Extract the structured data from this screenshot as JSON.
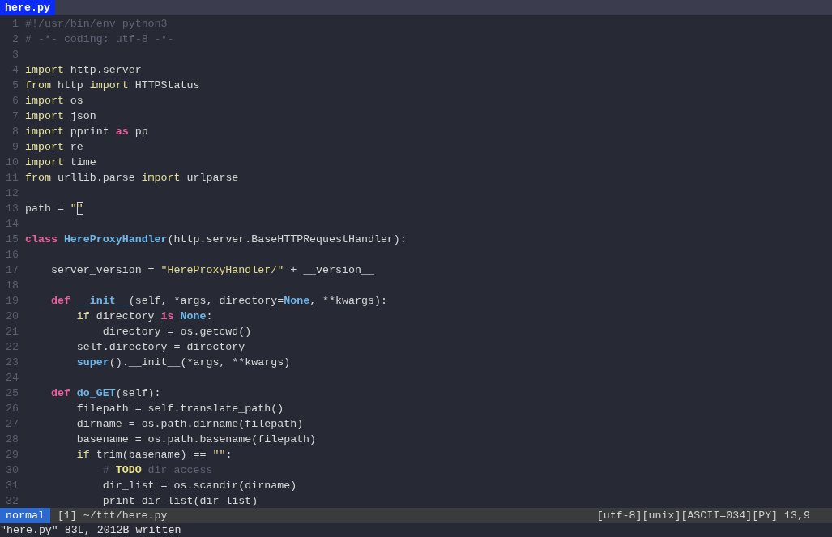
{
  "tabs": [
    {
      "label": "here.py",
      "selected": true
    }
  ],
  "lines": [
    {
      "number": "1",
      "tokens": [
        {
          "kind": "comment",
          "text": "#!/usr/bin/env python3"
        }
      ]
    },
    {
      "number": "2",
      "tokens": [
        {
          "kind": "comment",
          "text": "# -*- coding: utf-8 -*-"
        }
      ]
    },
    {
      "number": "3"
    },
    {
      "number": "4",
      "tokens": [
        {
          "kind": "keyword",
          "text": "import"
        },
        {
          "kind": "plain",
          "text": " http.server"
        }
      ]
    },
    {
      "number": "5",
      "tokens": [
        {
          "kind": "keyword",
          "text": "from"
        },
        {
          "kind": "plain",
          "text": " http "
        },
        {
          "kind": "keyword",
          "text": "import"
        },
        {
          "kind": "plain",
          "text": " HTTPStatus"
        }
      ]
    },
    {
      "number": "6",
      "tokens": [
        {
          "kind": "keyword",
          "text": "import"
        },
        {
          "kind": "plain",
          "text": " os"
        }
      ]
    },
    {
      "number": "7",
      "tokens": [
        {
          "kind": "keyword",
          "text": "import"
        },
        {
          "kind": "plain",
          "text": " json"
        }
      ]
    },
    {
      "number": "8",
      "tokens": [
        {
          "kind": "keyword",
          "text": "import"
        },
        {
          "kind": "plain",
          "text": " pprint "
        },
        {
          "kind": "statement",
          "text": "as"
        },
        {
          "kind": "plain",
          "text": " pp"
        }
      ]
    },
    {
      "number": "9",
      "tokens": [
        {
          "kind": "keyword",
          "text": "import"
        },
        {
          "kind": "plain",
          "text": " re"
        }
      ]
    },
    {
      "number": "10",
      "tokens": [
        {
          "kind": "keyword",
          "text": "import"
        },
        {
          "kind": "plain",
          "text": " time"
        }
      ]
    },
    {
      "number": "11",
      "tokens": [
        {
          "kind": "keyword",
          "text": "from"
        },
        {
          "kind": "plain",
          "text": " urllib.parse "
        },
        {
          "kind": "keyword",
          "text": "import"
        },
        {
          "kind": "plain",
          "text": " urlparse"
        }
      ]
    },
    {
      "number": "12"
    },
    {
      "number": "13",
      "tokens": [
        {
          "kind": "plain",
          "text": "path = "
        },
        {
          "kind": "string",
          "text": "\""
        },
        {
          "kind": "cursor",
          "text": "\""
        }
      ]
    },
    {
      "number": "14"
    },
    {
      "number": "15",
      "tokens": [
        {
          "kind": "statement",
          "text": "class"
        },
        {
          "kind": "function",
          "text": " HereProxyHandler"
        },
        {
          "kind": "plain",
          "text": "(http.server.BaseHTTPRequestHandler):"
        }
      ]
    },
    {
      "number": "16"
    },
    {
      "number": "17",
      "tokens": [
        {
          "kind": "plain",
          "text": "    server_version = "
        },
        {
          "kind": "string",
          "text": "\"HereProxyHandler/\""
        },
        {
          "kind": "plain",
          "text": " + __version__"
        }
      ]
    },
    {
      "number": "18"
    },
    {
      "number": "19",
      "tokens": [
        {
          "kind": "statement",
          "text": "    def"
        },
        {
          "kind": "function",
          "text": " __init__"
        },
        {
          "kind": "plain",
          "text": "(self, *args, directory="
        },
        {
          "kind": "function",
          "text": "None"
        },
        {
          "kind": "plain",
          "text": ", **kwargs):"
        }
      ]
    },
    {
      "number": "20",
      "tokens": [
        {
          "kind": "keyword",
          "text": "        if"
        },
        {
          "kind": "plain",
          "text": " directory "
        },
        {
          "kind": "statement",
          "text": "is"
        },
        {
          "kind": "function",
          "text": " None"
        },
        {
          "kind": "plain",
          "text": ":"
        }
      ]
    },
    {
      "number": "21",
      "tokens": [
        {
          "kind": "plain",
          "text": "            directory = os.getcwd()"
        }
      ]
    },
    {
      "number": "22",
      "tokens": [
        {
          "kind": "plain",
          "text": "        self.directory = directory"
        }
      ]
    },
    {
      "number": "23",
      "tokens": [
        {
          "kind": "function",
          "text": "        super"
        },
        {
          "kind": "plain",
          "text": "().__init__(*args, **kwargs)"
        }
      ]
    },
    {
      "number": "24"
    },
    {
      "number": "25",
      "tokens": [
        {
          "kind": "statement",
          "text": "    def"
        },
        {
          "kind": "function",
          "text": " do_GET"
        },
        {
          "kind": "plain",
          "text": "(self):"
        }
      ]
    },
    {
      "number": "26",
      "tokens": [
        {
          "kind": "plain",
          "text": "        filepath = self.translate_path()"
        }
      ]
    },
    {
      "number": "27",
      "tokens": [
        {
          "kind": "plain",
          "text": "        dirname = os.path.dirname(filepath)"
        }
      ]
    },
    {
      "number": "28",
      "tokens": [
        {
          "kind": "plain",
          "text": "        basename = os.path.basename(filepath)"
        }
      ]
    },
    {
      "number": "29",
      "tokens": [
        {
          "kind": "keyword",
          "text": "        if"
        },
        {
          "kind": "plain",
          "text": " trim(basename) == "
        },
        {
          "kind": "string",
          "text": "\"\""
        },
        {
          "kind": "plain",
          "text": ":"
        }
      ]
    },
    {
      "number": "30",
      "tokens": [
        {
          "kind": "comment",
          "text": "            # "
        },
        {
          "kind": "todo",
          "text": "TODO"
        },
        {
          "kind": "comment",
          "text": " dir access"
        }
      ]
    },
    {
      "number": "31",
      "tokens": [
        {
          "kind": "plain",
          "text": "            dir_list = os.scandir(dirname)"
        }
      ]
    },
    {
      "number": "32",
      "tokens": [
        {
          "kind": "plain",
          "text": "            print_dir_list(dir_list)"
        }
      ]
    }
  ],
  "status_bar": {
    "mode": "normal",
    "file": "[1] ~/ttt/here.py",
    "info": "[utf-8][unix][ASCII=034][PY] 13,9"
  },
  "message": "\"here.py\" 83L, 2012B written"
}
